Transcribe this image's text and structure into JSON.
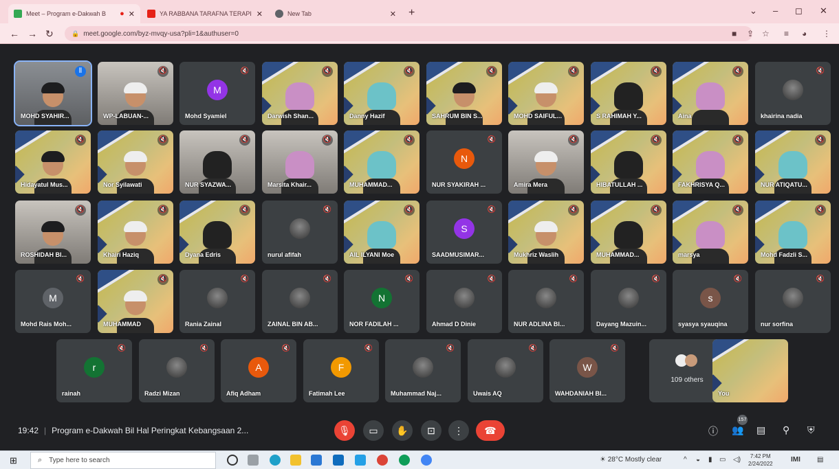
{
  "browser": {
    "tabs": [
      {
        "title": "Meet – Program e-Dakwah B",
        "favicon": "meet-favicon",
        "color": "#34a853"
      },
      {
        "title": "YA RABBANA TARAFNA TERAPI",
        "favicon": "youtube-favicon",
        "color": "#e62117"
      },
      {
        "title": "New Tab",
        "favicon": "chrome-favicon",
        "color": "#5f6368"
      }
    ],
    "url": "meet.google.com/byz-mvqy-usa?pli=1&authuser=0"
  },
  "participants": [
    {
      "name": "MOHD SYAHIR...",
      "tile": "cam",
      "speaking": true,
      "selected": true
    },
    {
      "name": "WP-LABUAN-...",
      "tile": "cam2"
    },
    {
      "name": "Mohd Syamiel",
      "tile": "avatar",
      "initial": "M",
      "avatar_color": "#9334e6"
    },
    {
      "name": "Darwish Shan...",
      "tile": "bg"
    },
    {
      "name": "Danny Hazif",
      "tile": "bg"
    },
    {
      "name": "SAHRUM BIN S...",
      "tile": "bg"
    },
    {
      "name": "MOHD SAIFUL...",
      "tile": "bg"
    },
    {
      "name": "S RAHIMAH Y...",
      "tile": "bg"
    },
    {
      "name": "Aina",
      "tile": "bg"
    },
    {
      "name": "khairina nadia",
      "tile": "photo"
    },
    {
      "name": "Hidayatul Mus...",
      "tile": "bg"
    },
    {
      "name": "Nor Syilawati",
      "tile": "bg"
    },
    {
      "name": "NUR SYAZWA...",
      "tile": "cam2"
    },
    {
      "name": "Marsita Khair...",
      "tile": "cam2"
    },
    {
      "name": "MUHAMMAD...",
      "tile": "bg"
    },
    {
      "name": "NUR SYAKIRAH ...",
      "tile": "avatar",
      "initial": "N",
      "avatar_color": "#e8590c"
    },
    {
      "name": "Amira Mera",
      "tile": "cam2"
    },
    {
      "name": "HIBATULLAH ...",
      "tile": "bg"
    },
    {
      "name": "FAKHRISYA Q...",
      "tile": "bg"
    },
    {
      "name": "NUR ATIQATU...",
      "tile": "bg"
    },
    {
      "name": "ROSHIDAH BI...",
      "tile": "cam2"
    },
    {
      "name": "Khairi Haziq",
      "tile": "bg"
    },
    {
      "name": "Dyana Edris",
      "tile": "bg"
    },
    {
      "name": "nurul afifah",
      "tile": "photo"
    },
    {
      "name": "AIL ILYANI Moe",
      "tile": "bg"
    },
    {
      "name": "SAADMUSIMAR...",
      "tile": "avatar",
      "initial": "S",
      "avatar_color": "#9334e6"
    },
    {
      "name": "Mukhriz Waslih",
      "tile": "bg"
    },
    {
      "name": "MUHAMMAD...",
      "tile": "bg"
    },
    {
      "name": "marsya",
      "tile": "bg"
    },
    {
      "name": "Mohd Fadzli S...",
      "tile": "bg"
    },
    {
      "name": "Mohd Rais Moh...",
      "tile": "avatar",
      "initial": "M",
      "avatar_color": "#5f6368"
    },
    {
      "name": "MUHAMMAD",
      "tile": "bg"
    },
    {
      "name": "Rania Zainal",
      "tile": "photo"
    },
    {
      "name": "ZAINAL BIN AB...",
      "tile": "photo"
    },
    {
      "name": "NOR FADILAH ...",
      "tile": "avatar",
      "initial": "N",
      "avatar_color": "#137333"
    },
    {
      "name": "Ahmad D Dinie",
      "tile": "photo"
    },
    {
      "name": "NUR ADLINA BI...",
      "tile": "photo"
    },
    {
      "name": "Dayang Mazuin...",
      "tile": "photo"
    },
    {
      "name": "syasya syauqina",
      "tile": "avatar",
      "initial": "s",
      "avatar_color": "#795548"
    },
    {
      "name": "nur sorfina",
      "tile": "photo"
    },
    {
      "name": "rainah",
      "tile": "avatar",
      "initial": "r",
      "avatar_color": "#137333"
    },
    {
      "name": "Radzi Mizan",
      "tile": "photo"
    },
    {
      "name": "Afiq Adham",
      "tile": "avatar",
      "initial": "A",
      "avatar_color": "#e8590c"
    },
    {
      "name": "Fatimah Lee",
      "tile": "avatar",
      "initial": "F",
      "avatar_color": "#f29900"
    },
    {
      "name": "Muhammad Naj...",
      "tile": "photo"
    },
    {
      "name": "Uwais AQ",
      "tile": "photo"
    },
    {
      "name": "WAHDANIAH BI...",
      "tile": "avatar",
      "initial": "W",
      "avatar_color": "#795548"
    }
  ],
  "others": {
    "label": "109 others"
  },
  "self": {
    "name": "You"
  },
  "meeting": {
    "time": "19:42",
    "title": "Program e-Dakwah Bil Hal Peringkat Kebangsaan 2...",
    "participant_count": "157"
  },
  "taskbar": {
    "search_placeholder": "Type here to search",
    "weather": "28°C  Mostly clear",
    "time": "7:42 PM",
    "date": "2/24/2022"
  }
}
